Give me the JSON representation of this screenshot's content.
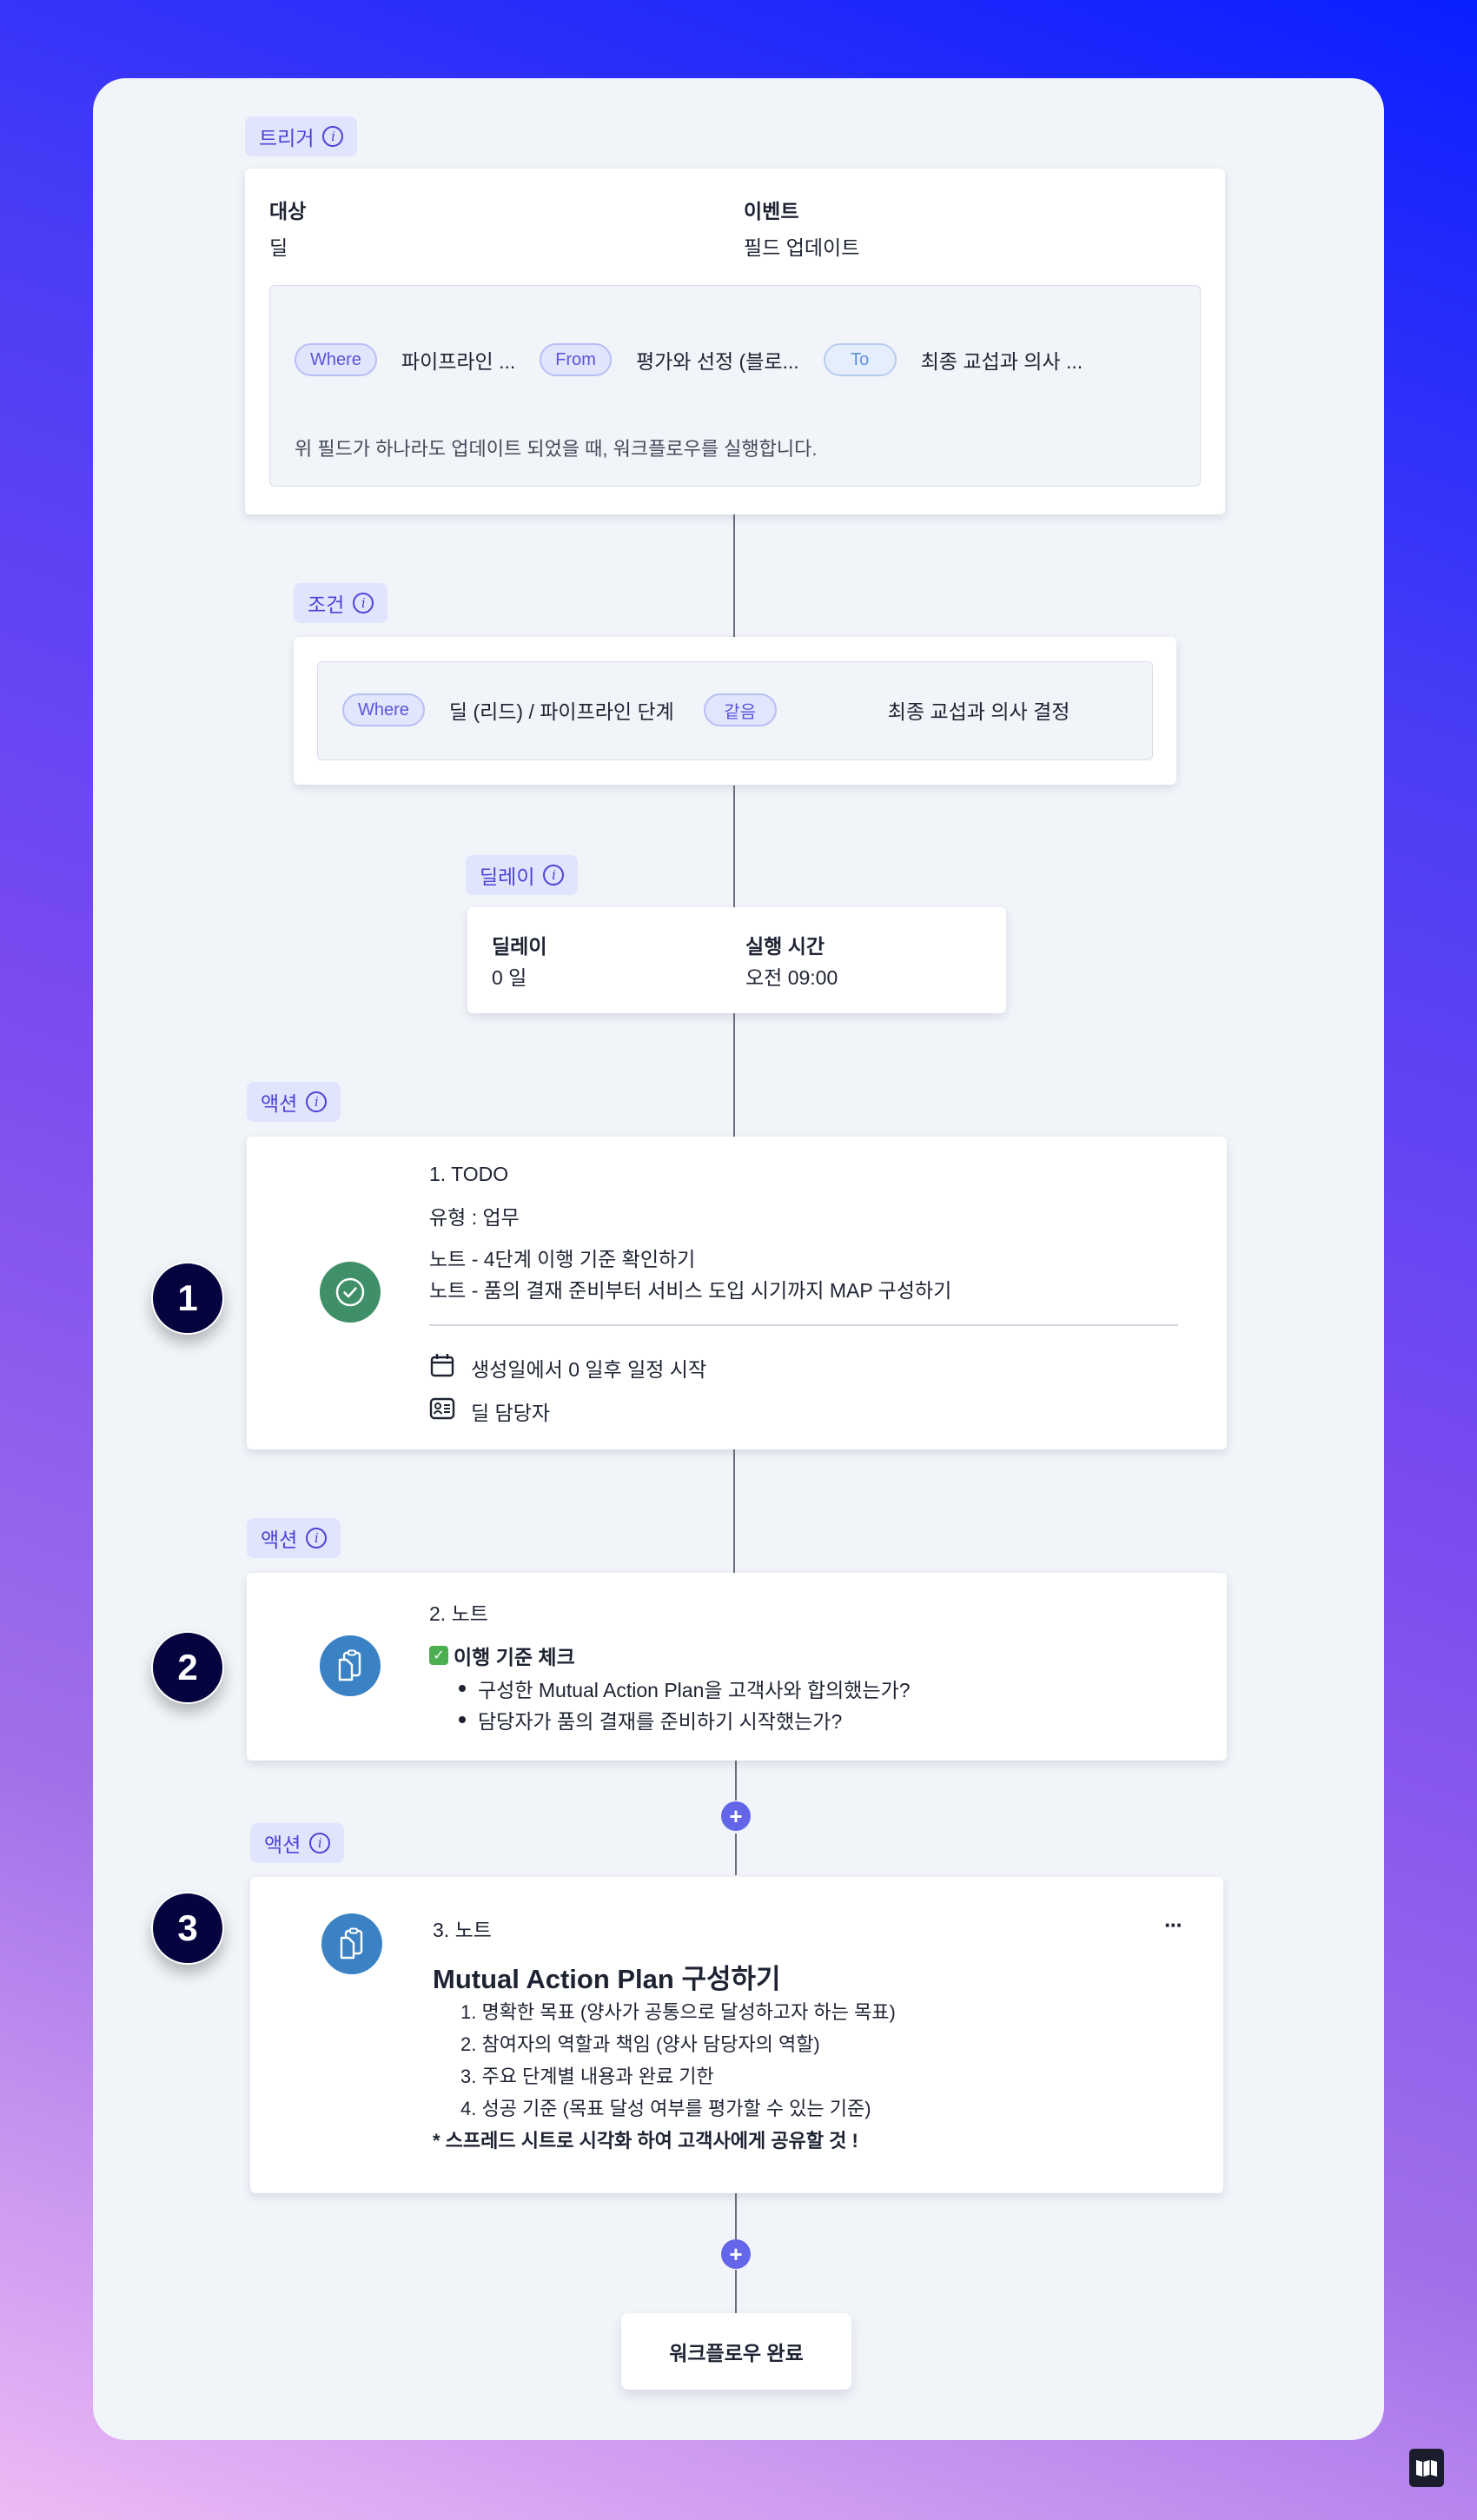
{
  "trigger": {
    "tag": "트리거",
    "target_label": "대상",
    "target_value": "딜",
    "event_label": "이벤트",
    "event_value": "필드 업데이트",
    "where_pill": "Where",
    "where_value": "파이프라인 ...",
    "from_pill": "From",
    "from_value": "평가와 선정 (블로...",
    "to_pill": "To",
    "to_value": "최종 교섭과 의사 ...",
    "note": "위 필드가 하나라도 업데이트 되었을 때, 워크플로우를 실행합니다."
  },
  "condition": {
    "tag": "조건",
    "where_pill": "Where",
    "field": "딜 (리드) / 파이프라인 단계",
    "op_pill": "같음",
    "value": "최종 교섭과 의사 결정"
  },
  "delay": {
    "tag": "딜레이",
    "delay_label": "딜레이",
    "delay_value": "0 일",
    "time_label": "실행 시간",
    "time_value": "오전 09:00"
  },
  "actions": [
    {
      "tag": "액션",
      "step": "1",
      "icon": "check-circle-icon",
      "icon_color": "#3f9068",
      "title": "1. TODO",
      "type_line": "유형 : 업무",
      "notes": [
        "노트 - 4단계 이행 기준 확인하기",
        "노트 - 품의 결재 준비부터 서비스 도입 시기까지 MAP 구성하기"
      ],
      "schedule": "생성일에서 0 일후 일정 시작",
      "assignee": "딜 담당자"
    },
    {
      "tag": "액션",
      "step": "2",
      "icon": "clipboard-icon",
      "icon_color": "#3b82c4",
      "title": "2. 노트",
      "heading_check": "✓",
      "heading": "이행 기준 체크",
      "bullets": [
        "구성한 Mutual Action Plan을 고객사와 합의했는가?",
        "담당자가 품의 결재를 준비하기 시작했는가?"
      ]
    },
    {
      "tag": "액션",
      "step": "3",
      "icon": "clipboard-icon",
      "icon_color": "#3b82c4",
      "title": "3. 노트",
      "heading": "Mutual Action Plan 구성하기",
      "items": [
        "1. 명확한 목표 (양사가 공통으로 달성하고자 하는 목표)",
        "2. 참여자의 역할과 책임 (양사 담당자의 역할)",
        "3. 주요 단계별 내용과 완료 기한",
        "4. 성공 기준 (목표 달성 여부를 평가할 수 있는 기준)"
      ],
      "footnote": "* 스프레드 시트로 시각화 하여 고객사에게 공유할 것 !",
      "more": "···"
    }
  ],
  "add_button": "+",
  "finish": "워크플로우 완료",
  "colors": {
    "accent": "#6366e8",
    "tag_bg": "#e0e5fd",
    "tag_text": "#4b42d6",
    "step_badge": "#05043f"
  }
}
